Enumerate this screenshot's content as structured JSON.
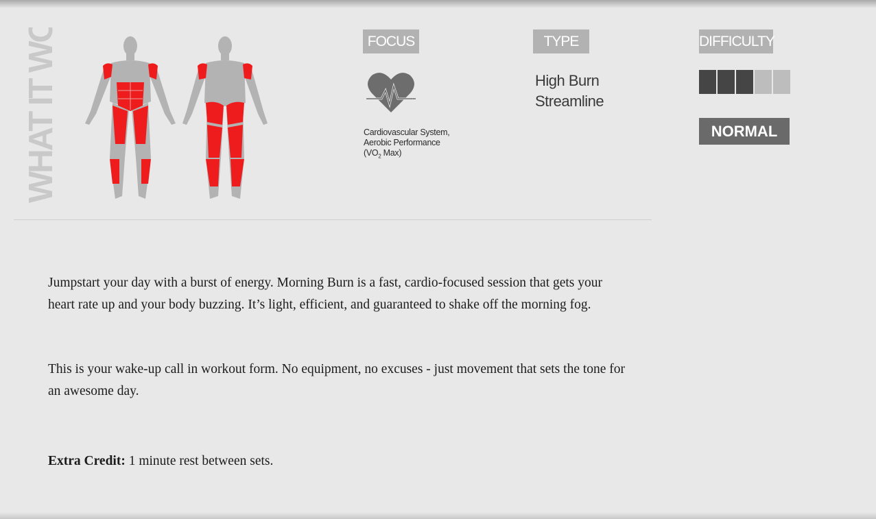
{
  "what_it_works": {
    "heading": "WHAT IT WORKS",
    "highlight_color": "#ee1c1c",
    "base_color": "#b3b3b3"
  },
  "focus": {
    "label": "FOCUS",
    "icon": "heart-pulse-icon",
    "line1": "Cardiovascular System,",
    "line2": "Aerobic Performance",
    "line3_prefix": "(VO",
    "line3_sub": "2",
    "line3_suffix": " Max)"
  },
  "type": {
    "label": "TYPE",
    "items": [
      "High Burn",
      "Streamline"
    ]
  },
  "difficulty": {
    "label": "DIFFICULTY",
    "level_filled": 3,
    "level_total": 5,
    "level_label": "NORMAL",
    "filled_color": "#454545",
    "empty_color": "#bdbdbd"
  },
  "description": {
    "paragraph1": "Jumpstart your day with a burst of energy. Morning Burn is a fast, cardio-focused session that gets your heart rate up and your body buzzing. It’s light, efficient, and guaranteed to shake off the morning fog.",
    "paragraph2": "This is your wake-up call in workout form. No equipment, no excuses - just movement that sets the tone for an awesome day.",
    "extra_credit_label": "Extra Credit:",
    "extra_credit_text": " 1 minute rest between sets."
  }
}
